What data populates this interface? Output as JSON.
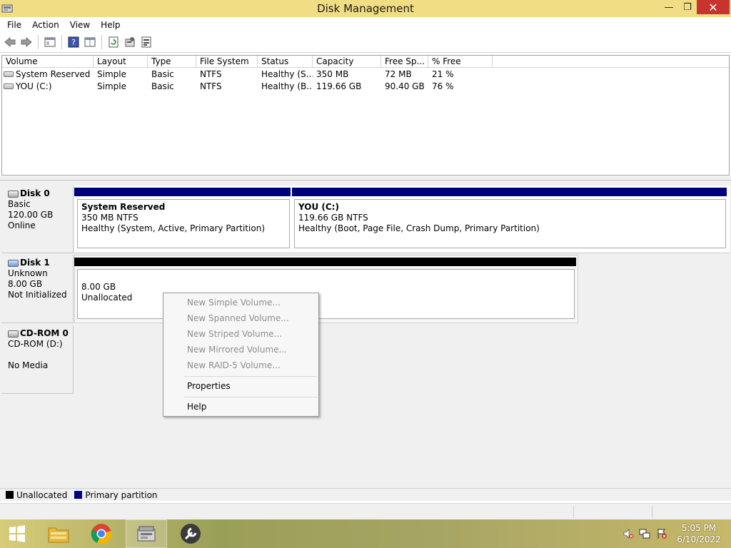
{
  "window": {
    "title": "Disk Management",
    "controls": {
      "minimize": "—",
      "maximize": "❐",
      "close": "✕"
    }
  },
  "menu": [
    "File",
    "Action",
    "View",
    "Help"
  ],
  "toolbar": {
    "icons": [
      "back-arrow-icon",
      "forward-arrow-icon",
      "console-tree-icon",
      "help-icon",
      "properties-grid-icon",
      "refresh-icon",
      "settings-icon",
      "properties-icon"
    ]
  },
  "volume_table": {
    "columns": [
      "Volume",
      "Layout",
      "Type",
      "File System",
      "Status",
      "Capacity",
      "Free Sp...",
      "% Free"
    ],
    "rows": [
      [
        "System Reserved",
        "Simple",
        "Basic",
        "NTFS",
        "Healthy (S...",
        "350 MB",
        "72 MB",
        "21 %"
      ],
      [
        "YOU (C:)",
        "Simple",
        "Basic",
        "NTFS",
        "Healthy (B...",
        "119.66 GB",
        "90.40 GB",
        "76 %"
      ]
    ]
  },
  "disks": [
    {
      "name": "Disk 0",
      "type": "Basic",
      "size": "120.00 GB",
      "status": "Online",
      "partitions": [
        {
          "name": "System Reserved",
          "size": "350 MB NTFS",
          "health": "Healthy (System, Active, Primary Partition)",
          "color": "#00007f"
        },
        {
          "name": "YOU  (C:)",
          "size": "119.66 GB NTFS",
          "health": "Healthy (Boot, Page File, Crash Dump, Primary Partition)",
          "color": "#00007f"
        }
      ]
    },
    {
      "name": "Disk 1",
      "type": "Unknown",
      "size": "8.00 GB",
      "status": "Not Initialized",
      "partitions": [
        {
          "size": "8.00 GB",
          "label": "Unallocated",
          "color": "#000000"
        }
      ]
    },
    {
      "name": "CD-ROM 0",
      "drive": "CD-ROM (D:)",
      "status": "No Media"
    }
  ],
  "context_menu": {
    "items": [
      "New Simple Volume...",
      "New Spanned Volume...",
      "New Striped Volume...",
      "New Mirrored Volume...",
      "New RAID-5 Volume...",
      "Properties",
      "Help"
    ],
    "disabled": [
      true,
      true,
      true,
      true,
      true,
      false,
      false
    ]
  },
  "legend": [
    {
      "label": "Unallocated",
      "color": "#000000"
    },
    {
      "label": "Primary partition",
      "color": "#00007f"
    }
  ],
  "taskbar": {
    "apps": [
      "start-icon",
      "file-explorer-icon",
      "chrome-icon",
      "disk-management-icon",
      "tools-icon"
    ],
    "time": "5:05 PM",
    "date": "6/10/2022"
  }
}
